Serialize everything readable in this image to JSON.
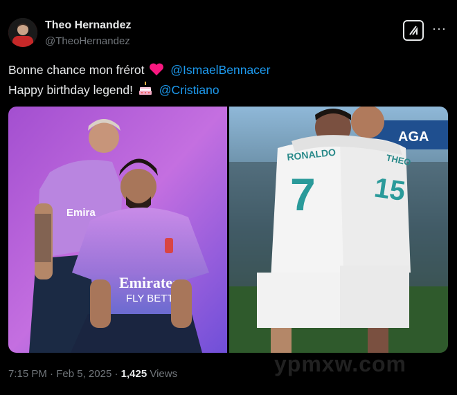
{
  "author": {
    "name": "Theo Hernandez",
    "handle": "@TheoHernandez"
  },
  "tweet": {
    "line1_text": "Bonne chance mon frérot",
    "line1_mention": "@IsmaelBennacer",
    "line2_text": "Happy birthday legend!",
    "line2_mention": "@Cristiano"
  },
  "media": {
    "left_jersey_sponsor_1": "Emirates",
    "left_jersey_sponsor_2": "FLY BETTER",
    "left_back_jersey_text": "Emira",
    "right_jersey_name_1": "RONALDO",
    "right_jersey_number_1": "7",
    "right_jersey_name_2": "THEO",
    "right_jersey_number_2": "15",
    "right_banner_text": "AGA"
  },
  "meta": {
    "time": "7:15 PM",
    "separator": "·",
    "date": "Feb 5, 2025",
    "views_count": "1,425",
    "views_label": "Views"
  },
  "watermark": "ypmxw.com",
  "colors": {
    "background": "#000000",
    "text": "#e7e9ea",
    "secondary": "#71767b",
    "link": "#1d9bf0",
    "heart": "#f91880"
  },
  "icons": [
    "avatar",
    "grok-icon",
    "more-icon",
    "heart-emoji",
    "cake-emoji"
  ]
}
